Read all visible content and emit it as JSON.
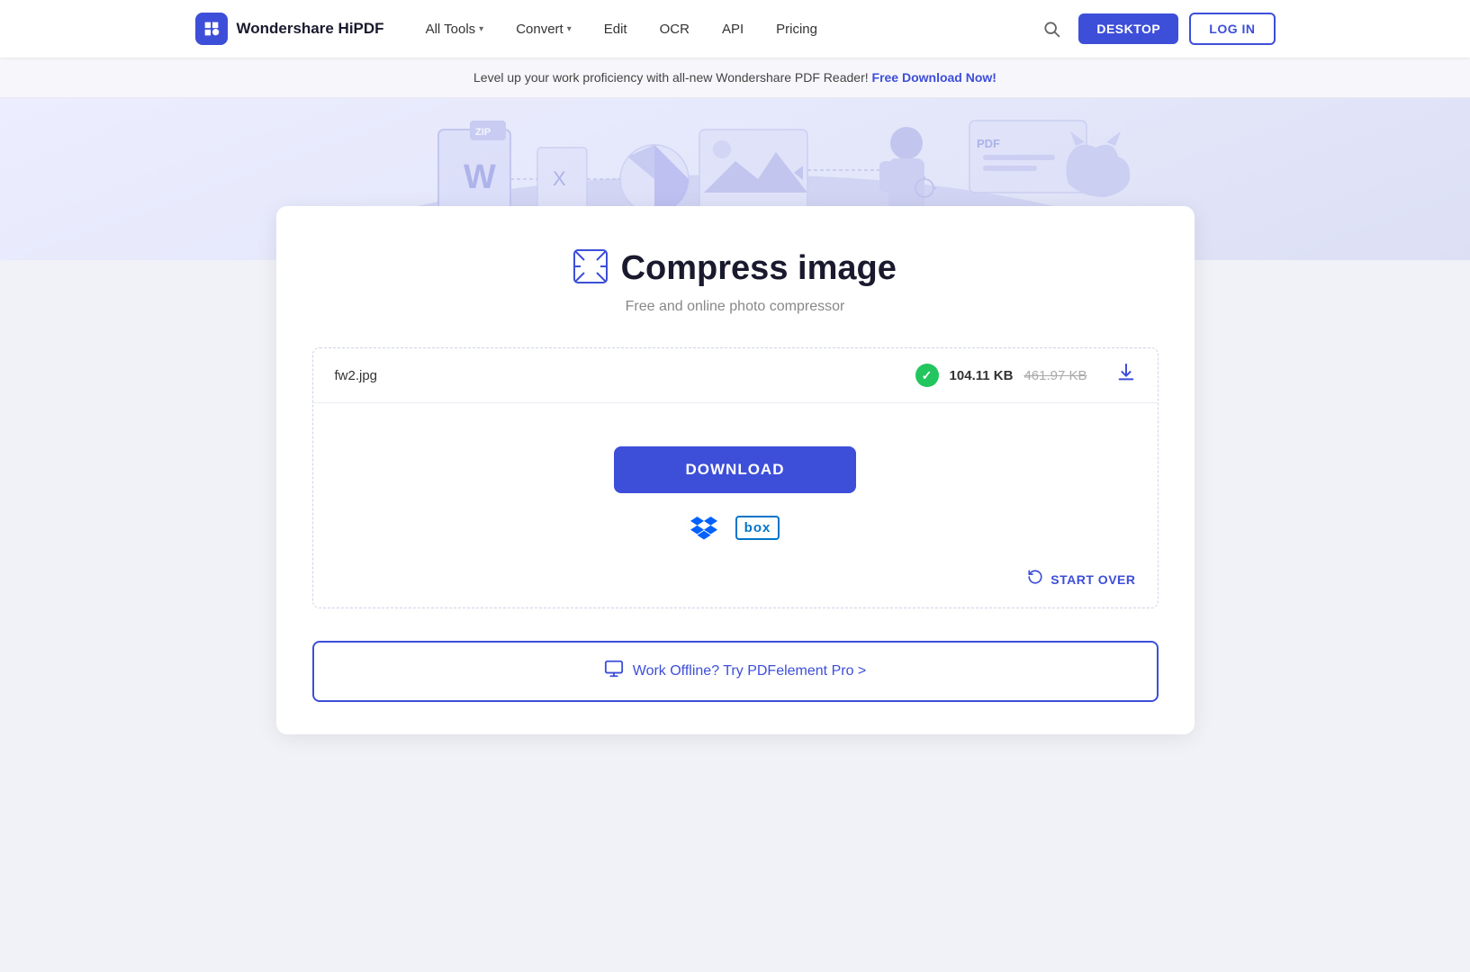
{
  "navbar": {
    "logo_text": "Wondershare HiPDF",
    "nav_items": [
      {
        "label": "All Tools",
        "has_chevron": true
      },
      {
        "label": "Convert",
        "has_chevron": true
      },
      {
        "label": "Edit",
        "has_chevron": false
      },
      {
        "label": "OCR",
        "has_chevron": false
      },
      {
        "label": "API",
        "has_chevron": false
      },
      {
        "label": "Pricing",
        "has_chevron": false
      }
    ],
    "btn_desktop": "DESKTOP",
    "btn_login": "LOG IN"
  },
  "banner": {
    "text": "Level up your work proficiency with all-new Wondershare PDF Reader!",
    "link_text": "Free Download Now!"
  },
  "page": {
    "title": "Compress image",
    "subtitle": "Free and online photo compressor",
    "file": {
      "name": "fw2.jpg",
      "new_size": "104.11 KB",
      "old_size": "461.97 KB"
    },
    "download_btn": "DOWNLOAD",
    "start_over": "START OVER",
    "offline_text": "Work Offline? Try PDFelement Pro >"
  },
  "colors": {
    "primary": "#3d4ed8",
    "success": "#22c55e"
  }
}
